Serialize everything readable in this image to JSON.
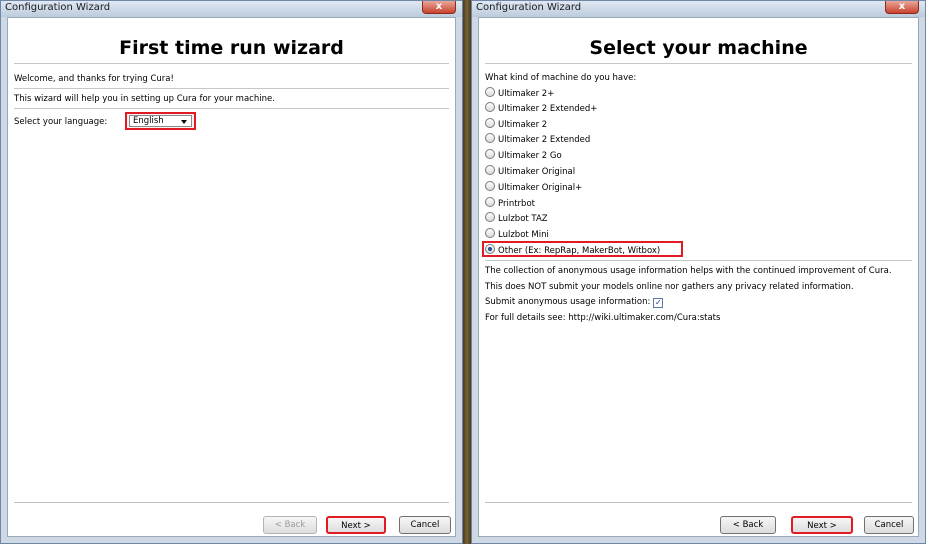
{
  "left_window": {
    "title": "Configuration Wizard",
    "close_label": "x",
    "heading": "First time run wizard",
    "welcome": "Welcome, and thanks for trying Cura!",
    "intro": "This wizard will help you in setting up Cura for your machine.",
    "language_label": "Select your language:",
    "language_value": "English",
    "buttons": {
      "back": "< Back",
      "next": "Next >",
      "cancel": "Cancel"
    }
  },
  "right_window": {
    "title": "Configuration Wizard",
    "close_label": "x",
    "heading": "Select your machine",
    "question": "What kind of machine do you have:",
    "machines": [
      "Ultimaker 2+",
      "Ultimaker 2 Extended+",
      "Ultimaker 2",
      "Ultimaker 2 Extended",
      "Ultimaker 2 Go",
      "Ultimaker Original",
      "Ultimaker Original+",
      "Printrbot",
      "Lulzbot TAZ",
      "Lulzbot Mini",
      "Other (Ex: RepRap, MakerBot, Witbox)"
    ],
    "selected_machine": "Other (Ex: RepRap, MakerBot, Witbox)",
    "usage_line1": "The collection of anonymous usage information helps with the continued improvement of Cura.",
    "usage_line2": "This does NOT submit your models online nor gathers any privacy related information.",
    "submit_label": "Submit anonymous usage information:",
    "submit_checked": true,
    "details": "For full details see: http://wiki.ultimaker.com/Cura:stats",
    "buttons": {
      "back": "< Back",
      "next": "Next >",
      "cancel": "Cancel"
    }
  },
  "colors": {
    "highlight": "#e21b23",
    "title_bar": "#cfd9e6",
    "client_bg": "#ffffff"
  }
}
